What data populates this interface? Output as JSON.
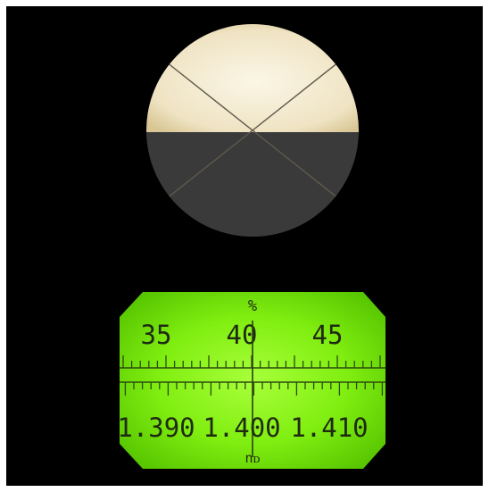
{
  "eyepiece": {
    "upper_field_color": "#f3ead2",
    "lower_field_color": "#3b3b3c",
    "crosshair_color": "#5c5648"
  },
  "scale": {
    "background_color": "#78e800",
    "ink_color": "#1f2a12",
    "top_unit": "%",
    "top_labels": [
      "35",
      "40",
      "45"
    ],
    "bottom_labels": [
      "1.390",
      "1.400",
      "1.410"
    ],
    "bottom_unit": "nᴅ",
    "reading_line_position": 0.4
  }
}
